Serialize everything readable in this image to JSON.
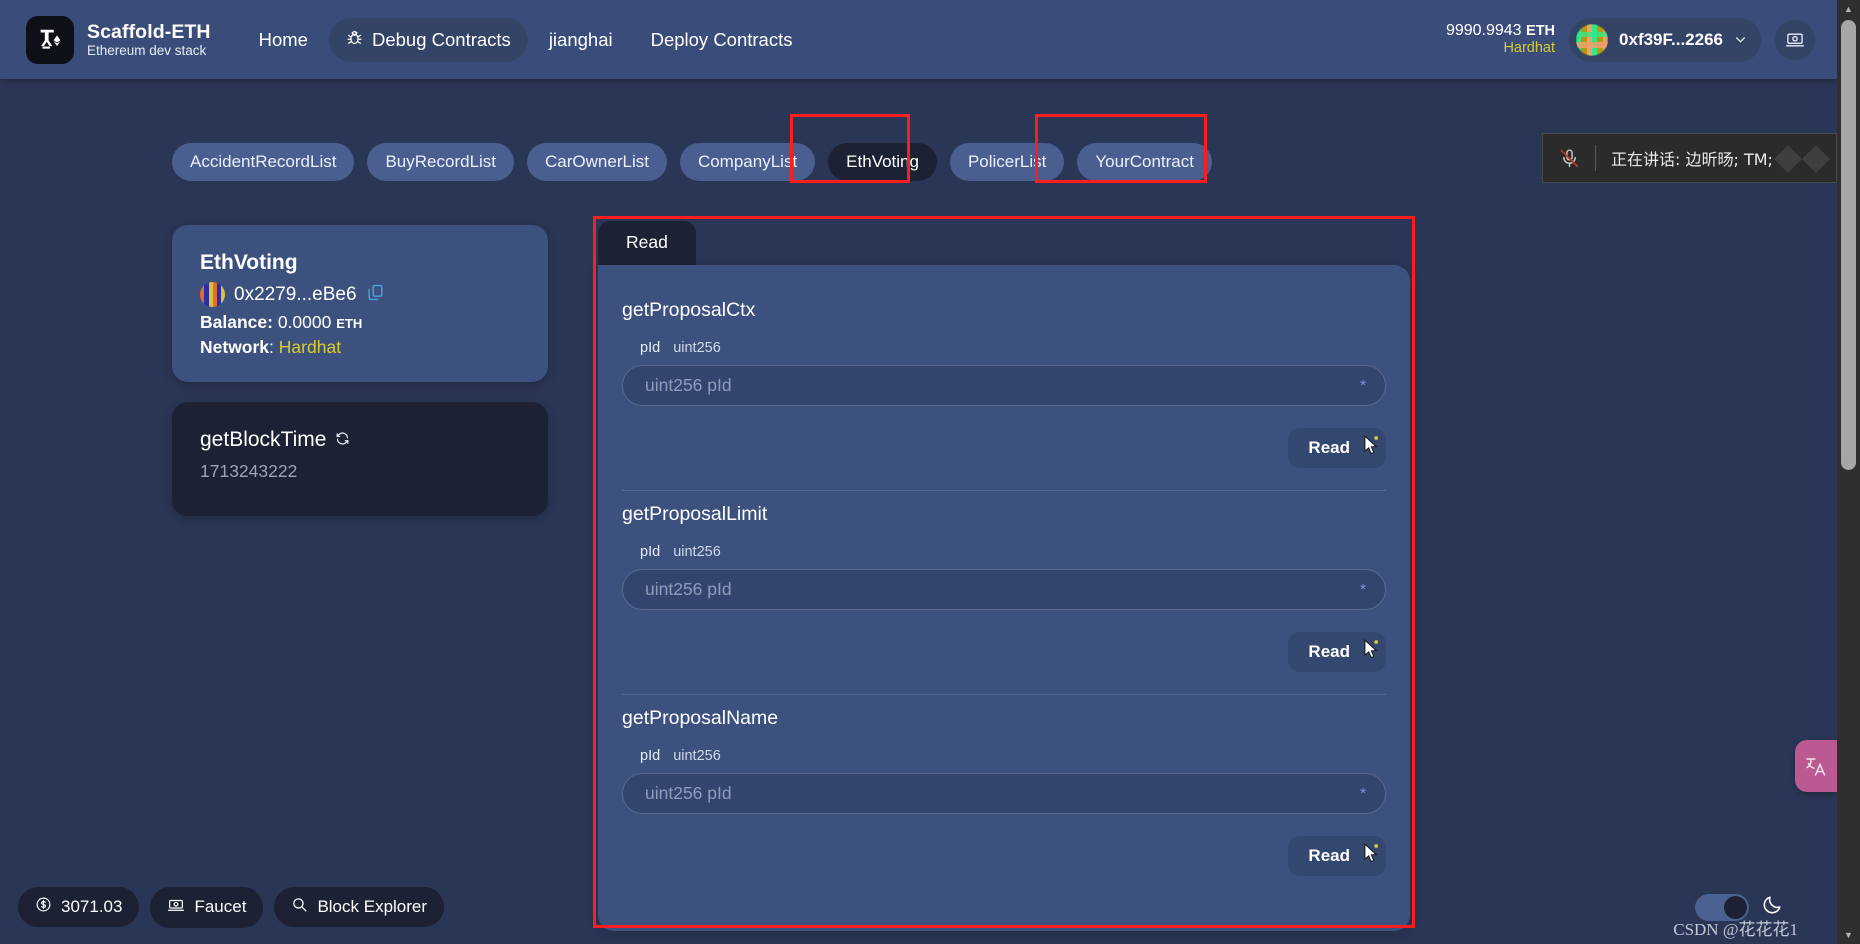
{
  "header": {
    "logo_icon": "scaffold-crane-ethereum-icon",
    "brand_title": "Scaffold-ETH",
    "brand_subtitle": "Ethereum dev stack",
    "nav": [
      {
        "label": "Home",
        "icon": null,
        "active": false
      },
      {
        "label": "Debug Contracts",
        "icon": "bug-icon",
        "active": true
      },
      {
        "label": "jianghai",
        "icon": null,
        "active": false
      },
      {
        "label": "Deploy Contracts",
        "icon": null,
        "active": false
      }
    ],
    "balance": "9990.9943",
    "balance_unit": "ETH",
    "network": "Hardhat",
    "account_address": "0xf39F...2266",
    "account_chevron_icon": "chevron-down-icon",
    "avatar_icon": "blockie-avatar",
    "screencast_button_icon": "screencast-icon"
  },
  "contract_tabs": [
    {
      "label": "AccidentRecordList",
      "active": false
    },
    {
      "label": "BuyRecordList",
      "active": false
    },
    {
      "label": "CarOwnerList",
      "active": false
    },
    {
      "label": "CompanyList",
      "active": false
    },
    {
      "label": "EthVoting",
      "active": true
    },
    {
      "label": "PolicerList",
      "active": false
    },
    {
      "label": "YourContract",
      "active": false
    }
  ],
  "contract_info": {
    "name": "EthVoting",
    "address": "0x2279...eBe6",
    "address_blockie_icon": "blockie-avatar",
    "copy_icon": "copy-icon",
    "balance_label": "Balance:",
    "balance_value": "0.0000",
    "balance_unit": "ETH",
    "network_label": "Network",
    "network_value": "Hardhat"
  },
  "block_time_card": {
    "title": "getBlockTime",
    "refresh_icon": "refresh-icon",
    "value": "1713243222"
  },
  "read_panel": {
    "tab_label": "Read",
    "functions": [
      {
        "name": "getProposalCtx",
        "param_name": "pId",
        "param_type": "uint256",
        "input_placeholder": "uint256 pId",
        "input_value": "",
        "required_marker": "*",
        "button_label": "Read",
        "cursor_icon": "mouse-pointer-icon"
      },
      {
        "name": "getProposalLimit",
        "param_name": "pId",
        "param_type": "uint256",
        "input_placeholder": "uint256 pId",
        "input_value": "",
        "required_marker": "*",
        "button_label": "Read",
        "cursor_icon": "mouse-pointer-icon"
      },
      {
        "name": "getProposalName",
        "param_name": "pId",
        "param_type": "uint256",
        "input_placeholder": "uint256 pId",
        "input_value": "",
        "required_marker": "*",
        "button_label": "Read",
        "cursor_icon": "mouse-pointer-icon"
      }
    ]
  },
  "footer": {
    "gas_price": "3071.03",
    "gas_icon": "dollar-circle-icon",
    "faucet_label": "Faucet",
    "faucet_icon": "faucet-banknote-icon",
    "block_explorer_label": "Block Explorer",
    "block_explorer_icon": "search-icon",
    "theme_toggle_icon": "toggle-switch",
    "theme_icon": "moon-icon",
    "watermark": "CSDN @花花花1"
  },
  "overlays": {
    "toast": {
      "mic_icon": "microphone-muted-icon",
      "text": "正在讲话: 边昕旸; TM;"
    },
    "translate_fab_icon": "translate-icon"
  },
  "colors": {
    "page_bg": "#2a3655",
    "header_bg": "#3a4d7a",
    "card_bg": "#3c517e",
    "dark_card_bg": "#1c2234",
    "accent_yellow": "#d8cc2e",
    "highlight_red": "#fc1d1d",
    "tab_bg": "#4a5f8f"
  }
}
